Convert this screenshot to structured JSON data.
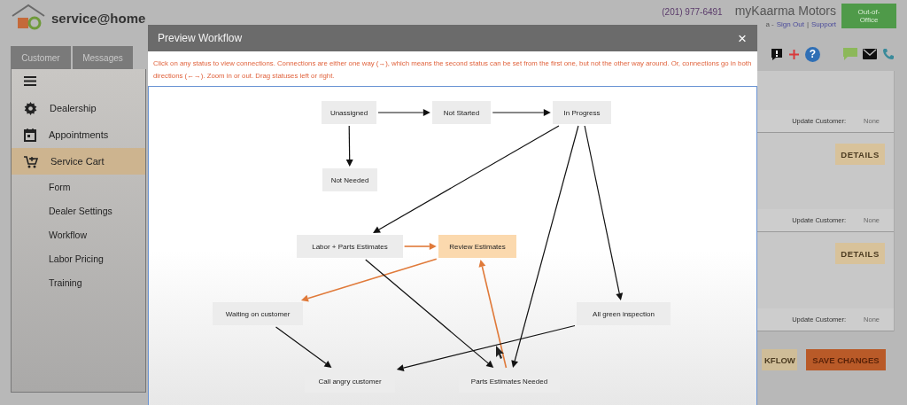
{
  "app": {
    "logo_text": "service@home"
  },
  "header": {
    "help_label": "?",
    "phone": "(201) 977-6491",
    "dealer_name": "myKaarma Motors",
    "user_fragment": "a -",
    "sign_out": "Sign Out",
    "separator": "|",
    "support": "Support",
    "status_button": "Out-of-Office"
  },
  "tabs": [
    {
      "label": "Customer"
    },
    {
      "label": "Messages"
    }
  ],
  "sidebar": {
    "items": [
      {
        "label": "Dealership",
        "selected": false
      },
      {
        "label": "Appointments",
        "selected": false
      },
      {
        "label": "Service Cart",
        "selected": true,
        "children": [
          {
            "label": "Form"
          },
          {
            "label": "Dealer Settings"
          },
          {
            "label": "Workflow"
          },
          {
            "label": "Labor Pricing"
          },
          {
            "label": "Training"
          }
        ]
      }
    ]
  },
  "right_panel": {
    "rows": [
      {
        "kind": "update",
        "label": "Update Customer:",
        "value": "None"
      },
      {
        "kind": "details",
        "label": "DETAILS"
      },
      {
        "kind": "update",
        "label": "Update Customer:",
        "value": "None"
      },
      {
        "kind": "details",
        "label": "DETAILS"
      },
      {
        "kind": "update",
        "label": "Update Customer:",
        "value": "None"
      }
    ]
  },
  "footer_buttons": [
    {
      "label": "KFLOW",
      "kind": "secondary"
    },
    {
      "label": "SAVE CHANGES",
      "kind": "primary"
    }
  ],
  "modal": {
    "title": "Preview Workflow",
    "close_label": "×",
    "instructions": "Click on any status to view connections. Connections are either one way (→), which means the second status can be set from the first one, but not the other way around. Or, connections go in both directions (←→). Zoom in or out. Drag statuses left or right.",
    "statuses": [
      {
        "label": "Unassigned",
        "highlighted": false
      },
      {
        "label": "Not Started",
        "highlighted": false
      },
      {
        "label": "In Progress",
        "highlighted": false
      },
      {
        "label": "Not Needed",
        "highlighted": false
      },
      {
        "label": "Labor + Parts Estimates",
        "highlighted": false
      },
      {
        "label": "Review Estimates",
        "highlighted": true
      },
      {
        "label": "Waiting on customer",
        "highlighted": false
      },
      {
        "label": "All green inspection",
        "highlighted": false
      },
      {
        "label": "Call angry customer",
        "highlighted": false
      },
      {
        "label": "Parts Estimates Needed",
        "highlighted": false
      }
    ],
    "connections": [
      {
        "highlighted": false
      },
      {
        "highlighted": false
      },
      {
        "highlighted": false
      },
      {
        "highlighted": false
      },
      {
        "highlighted": false
      },
      {
        "highlighted": false
      },
      {
        "highlighted": true
      },
      {
        "highlighted": true
      },
      {
        "highlighted": true
      },
      {
        "highlighted": false
      },
      {
        "highlighted": false
      },
      {
        "highlighted": false
      }
    ]
  }
}
